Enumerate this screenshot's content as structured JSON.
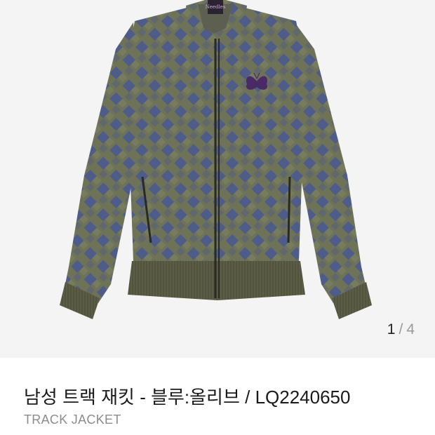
{
  "gallery": {
    "current": "1",
    "separator": "/",
    "total": "4",
    "image": "product-photo-track-jacket",
    "colors": {
      "body": "#6d7257",
      "check": "#4b5a8a",
      "rib": "#5d5d44",
      "butterfly": "#4a2a66"
    }
  },
  "product": {
    "title": "남성 트랙 재킷 - 블루:올리브 / LQ2240650",
    "subtitle": "TRACK JACKET"
  }
}
